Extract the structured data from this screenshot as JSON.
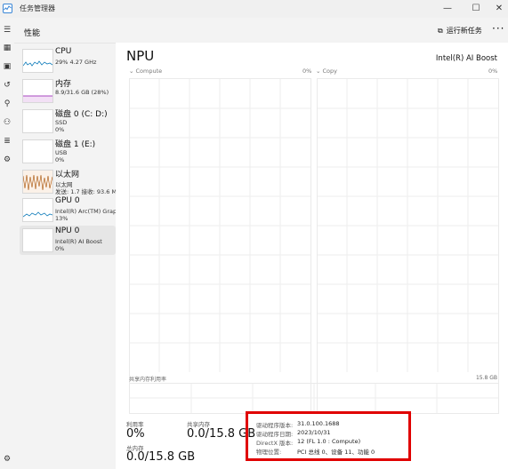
{
  "window": {
    "title": "任务管理器"
  },
  "header": {
    "title": "性能",
    "run_task": "运行新任务"
  },
  "sidebar": {
    "items": [
      {
        "name": "CPU",
        "line1": "29% 4.27 GHz",
        "line2": "",
        "line3": ""
      },
      {
        "name": "内存",
        "line1": "8.9/31.6 GB (28%)",
        "line2": "",
        "line3": ""
      },
      {
        "name": "磁盘 0 (C: D:)",
        "line1": "SSD",
        "line2": "0%",
        "line3": ""
      },
      {
        "name": "磁盘 1 (E:)",
        "line1": "USB",
        "line2": "0%",
        "line3": ""
      },
      {
        "name": "以太网",
        "line1": "以太网",
        "line2": "发送: 1.7 接收: 93.6 MI",
        "line3": ""
      },
      {
        "name": "GPU 0",
        "line1": "Intel(R) Arc(TM) Grap.",
        "line2": "13%",
        "line3": ""
      },
      {
        "name": "NPU 0",
        "line1": "Intel(R) AI Boost",
        "line2": "0%",
        "line3": ""
      }
    ]
  },
  "main": {
    "title": "NPU",
    "device": "Intel(R) AI Boost",
    "graphs": [
      {
        "label": "Compute",
        "pct": "0%"
      },
      {
        "label": "Copy",
        "pct": "0%"
      }
    ],
    "shared_label": "共享内存利用率",
    "shared_max": "15.8 GB",
    "stats": {
      "util_label": "利用率",
      "util_value": "0%",
      "shared_label": "共享内存",
      "shared_value": "0.0/15.8 GB",
      "total_label": "总内存",
      "total_value": "0.0/15.8 GB"
    },
    "info": [
      {
        "key": "驱动程序版本:",
        "value": "31.0.100.1688"
      },
      {
        "key": "驱动程序日期:",
        "value": "2023/10/31"
      },
      {
        "key": "DirectX 版本:",
        "value": "12 (FL 1.0 : Compute)"
      },
      {
        "key": "物理位置:",
        "value": "PCI 总线 0、设备 11、功能 0"
      }
    ]
  },
  "colors": {
    "highlight": "#e00000",
    "cpu": "#117dbb",
    "memory": "#8b12ae",
    "ethernet": "#a74f01"
  }
}
